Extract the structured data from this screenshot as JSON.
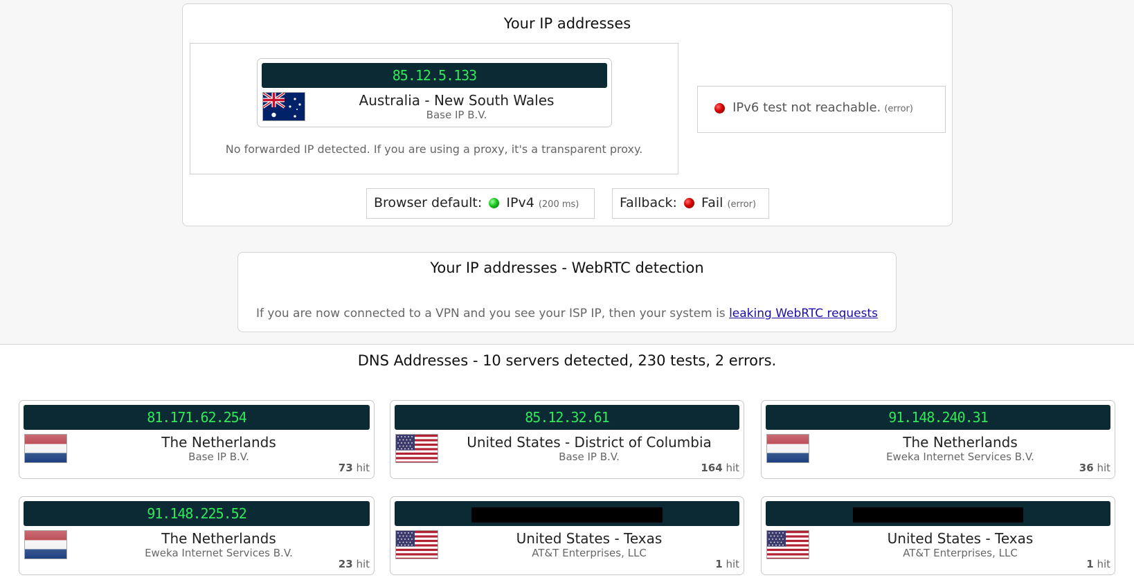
{
  "ip_panel": {
    "title": "Your IP addresses",
    "ip": "85.12.5.133",
    "location": "Australia - New South Wales",
    "isp": "Base IP B.V.",
    "forwarded_note": "No forwarded IP detected. If you are using a proxy, it's a transparent proxy.",
    "ipv6_message": "IPv6 test not reachable.",
    "ipv6_tag": "(error)",
    "browser_default_label": "Browser default:",
    "browser_default_value": "IPv4",
    "browser_default_time": "(200 ms)",
    "fallback_label": "Fallback:",
    "fallback_value": "Fail",
    "fallback_tag": "(error)"
  },
  "webrtc_panel": {
    "title": "Your IP addresses - WebRTC detection",
    "note": "If you are now connected to a VPN and you see your ISP IP, then your system is",
    "link": "leaking WebRTC requests"
  },
  "dns": {
    "title": "DNS Addresses - 10 servers detected, 230 tests, 2 errors.",
    "hit_suffix": "hit",
    "servers": [
      {
        "ip": "81.171.62.254",
        "location": "The Netherlands",
        "isp": "Base IP B.V.",
        "hits": "73",
        "flag": "nl"
      },
      {
        "ip": "85.12.32.61",
        "location": "United States - District of Columbia",
        "isp": "Base IP B.V.",
        "hits": "164",
        "flag": "us"
      },
      {
        "ip": "91.148.240.31",
        "location": "The Netherlands",
        "isp": "Eweka Internet Services B.V.",
        "hits": "36",
        "flag": "nl"
      },
      {
        "ip": "91.148.225.52",
        "location": "The Netherlands",
        "isp": "Eweka Internet Services B.V.",
        "hits": "23",
        "flag": "nl"
      },
      {
        "ip": "",
        "location": "United States - Texas",
        "isp": "AT&T Enterprises, LLC",
        "hits": "1",
        "flag": "us"
      },
      {
        "ip": "",
        "location": "United States - Texas",
        "isp": "AT&T Enterprises, LLC",
        "hits": "1",
        "flag": "us"
      }
    ]
  },
  "colors": {
    "ip_bar_bg": "#0c2a33",
    "ip_text": "#31e85a",
    "status_ok": "#1bc41b",
    "status_error": "#d30000"
  }
}
